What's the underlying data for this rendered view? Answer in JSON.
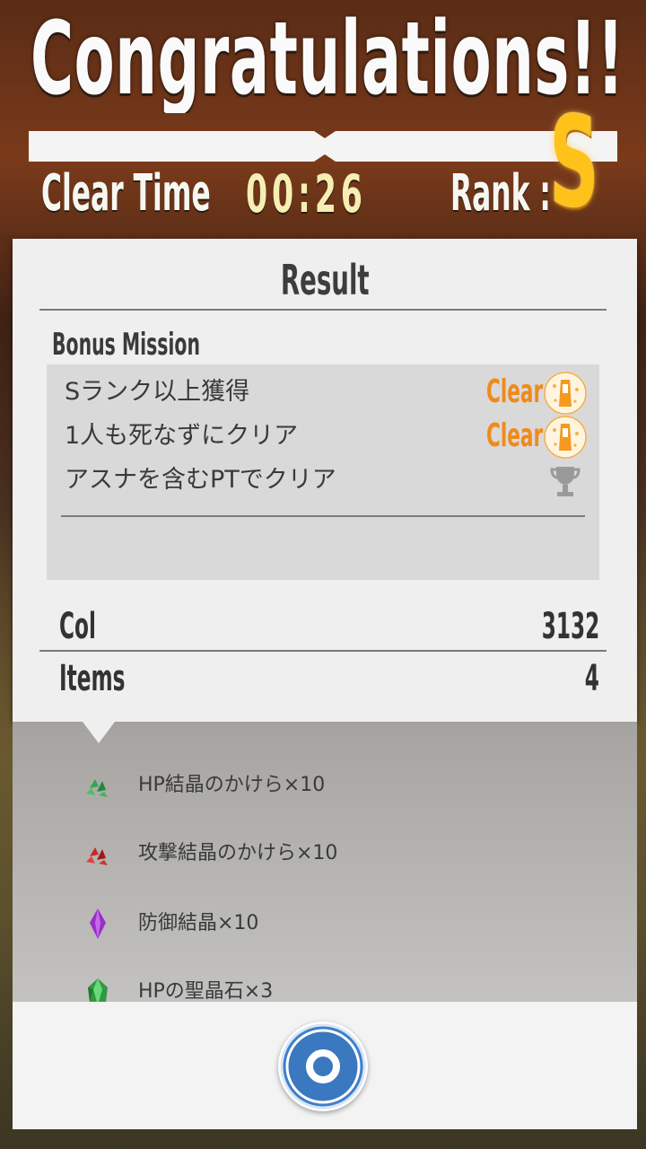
{
  "header": {
    "title": "Congratulations!!",
    "clear_time_label": "Clear Time",
    "clear_time_value": "00:26",
    "rank_label": "Rank :",
    "rank_value": "S"
  },
  "result": {
    "title": "Result",
    "bonus_heading": "Bonus Mission",
    "missions": [
      {
        "text": "Sランク以上獲得",
        "status": "Clear",
        "icon": "trophy-cleared-icon"
      },
      {
        "text": "1人も死なずにクリア",
        "status": "Clear",
        "icon": "trophy-cleared-icon"
      },
      {
        "text": "アスナを含むPTでクリア",
        "status": "",
        "icon": "trophy-icon"
      }
    ],
    "col_label": "Col",
    "col_value": "3132",
    "items_label": "Items",
    "items_value": "4"
  },
  "items": [
    {
      "name": "HP結晶のかけら×10",
      "icon": "green-crystal-shard-icon"
    },
    {
      "name": "攻撃結晶のかけら×10",
      "icon": "red-crystal-shard-icon"
    },
    {
      "name": "防御結晶×10",
      "icon": "purple-crystal-icon"
    },
    {
      "name": "HPの聖晶石×3",
      "icon": "green-holy-crystal-icon"
    }
  ],
  "colors": {
    "clear_orange": "#f08a1a",
    "rank_gold": "#ffc21a",
    "ok_button_blue": "#3f7fc8"
  },
  "footer": {
    "ok_icon": "circle-ok-icon"
  }
}
